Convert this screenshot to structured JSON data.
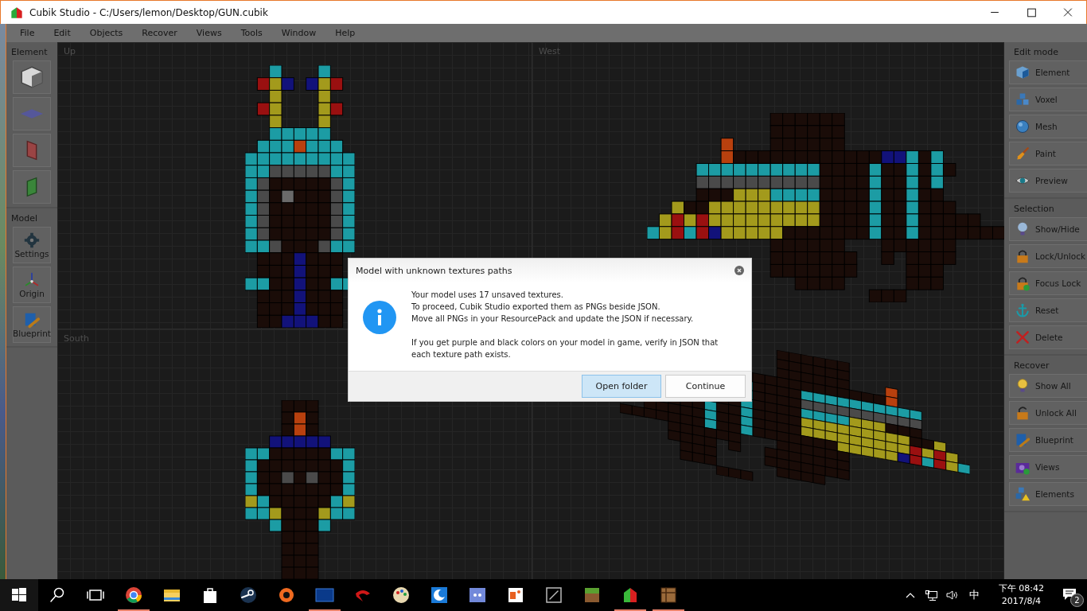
{
  "window": {
    "title": "Cubik Studio - C:/Users/lemon/Desktop/GUN.cubik"
  },
  "menu": [
    "File",
    "Edit",
    "Objects",
    "Recover",
    "Views",
    "Tools",
    "Window",
    "Help"
  ],
  "left_toolbar": [
    {
      "title": "Element",
      "tools": [
        {
          "kind": "cube"
        },
        {
          "kind": "plane-top"
        },
        {
          "kind": "plane-red"
        },
        {
          "kind": "plane-green"
        }
      ]
    },
    {
      "title": "Model",
      "tools": [
        {
          "kind": "gear",
          "label": "Settings"
        },
        {
          "kind": "axes",
          "label": "Origin"
        },
        {
          "kind": "blueprint",
          "label": "Blueprint"
        }
      ]
    }
  ],
  "viewports": [
    {
      "kind": "top",
      "label": "Up"
    },
    {
      "kind": "west",
      "label": "West"
    },
    {
      "kind": "south",
      "label": "South"
    },
    {
      "kind": "perspective"
    }
  ],
  "right_toolbar": [
    {
      "title": "Edit mode",
      "tools": [
        {
          "kind": "cube-blue",
          "label": "Element"
        },
        {
          "kind": "voxel",
          "label": "Voxel"
        },
        {
          "kind": "sphere",
          "label": "Mesh"
        },
        {
          "kind": "brush",
          "label": "Paint"
        },
        {
          "kind": "eye",
          "label": "Preview"
        }
      ]
    },
    {
      "title": "Selection",
      "tools": [
        {
          "kind": "bulb",
          "label": "Show/Hide"
        },
        {
          "kind": "lock",
          "label": "Lock/Unlock"
        },
        {
          "kind": "lock-check",
          "label": "Focus Lock"
        },
        {
          "kind": "anchor",
          "label": "Reset"
        },
        {
          "kind": "cross",
          "label": "Delete"
        }
      ]
    },
    {
      "title": "Recover",
      "tools": [
        {
          "kind": "bulb-lit",
          "label": "Show All"
        },
        {
          "kind": "lock-open",
          "label": "Unlock All"
        },
        {
          "kind": "blueprint",
          "label": "Blueprint"
        },
        {
          "kind": "camera-check",
          "label": "Views"
        },
        {
          "kind": "cubes-warning",
          "label": "Elements"
        }
      ]
    }
  ],
  "dialog": {
    "title": "Model with unknown textures paths",
    "lines": [
      "Your model uses 17 unsaved textures.",
      "To proceed, Cubik Studio exported them as PNGs beside JSON.",
      "Move all PNGs in your ResourcePack and update the JSON if necessary."
    ],
    "note": "If you get purple and black colors on your model in game, verify in JSON that each texture path exists.",
    "buttons": [
      {
        "label": "Open folder",
        "focused": true
      },
      {
        "label": "Continue",
        "focused": false
      }
    ]
  },
  "taskbar": {
    "apps": [
      {
        "kind": "chrome",
        "running": true
      },
      {
        "kind": "folder",
        "running": false
      },
      {
        "kind": "store",
        "running": false
      },
      {
        "kind": "steam",
        "running": false
      },
      {
        "kind": "origin",
        "running": false
      },
      {
        "kind": "blizzard",
        "running": true
      },
      {
        "kind": "garena",
        "running": false
      },
      {
        "kind": "palette",
        "running": false
      },
      {
        "kind": "moon",
        "running": false
      },
      {
        "kind": "discord",
        "running": false
      },
      {
        "kind": "slides",
        "running": false
      },
      {
        "kind": "frame",
        "running": false
      },
      {
        "kind": "grass",
        "running": false
      },
      {
        "kind": "cubik",
        "running": true
      },
      {
        "kind": "crate",
        "running": true
      }
    ],
    "input_method": "中",
    "time": "下午 08:42",
    "date": "2017/8/4",
    "notifications": "2"
  }
}
